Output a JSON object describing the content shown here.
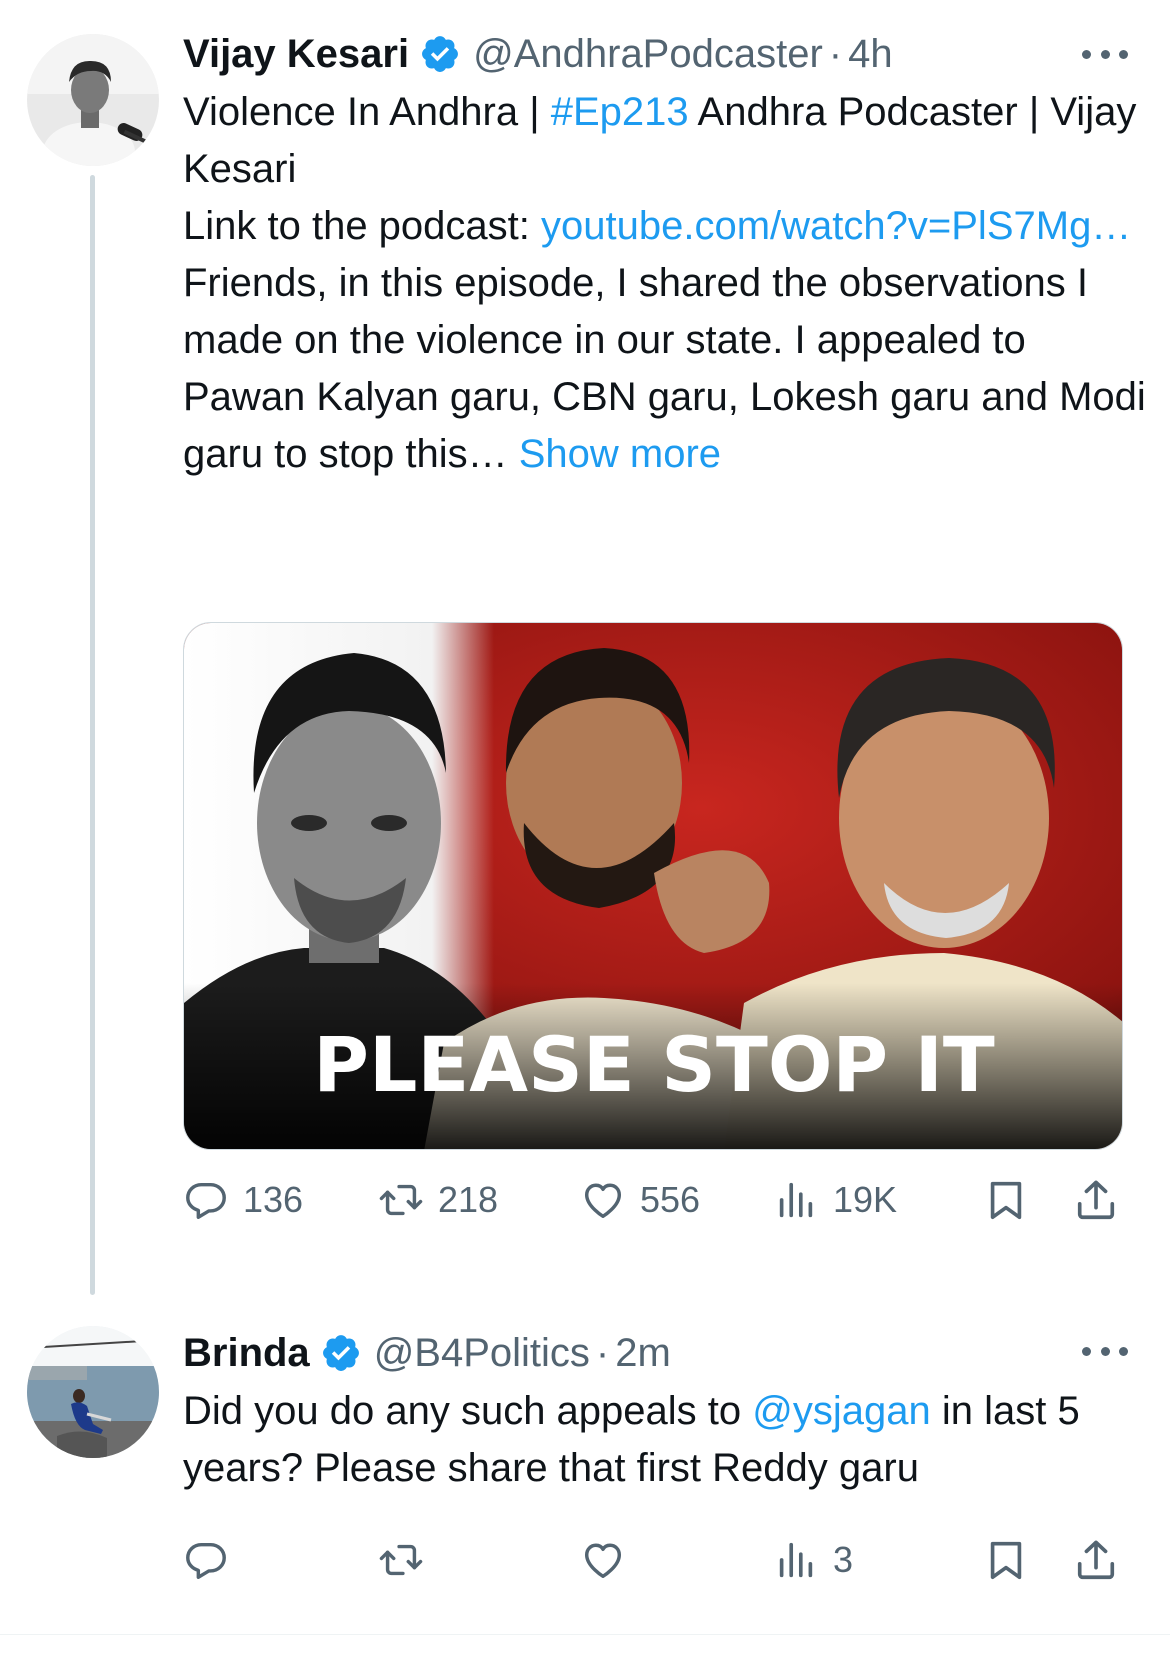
{
  "main_tweet": {
    "author_name": "Vijay Kesari",
    "handle": "@AndhraPodcaster",
    "separator": "·",
    "time": "4h",
    "text": {
      "line1_start": "Violence In Andhra | ",
      "hashtag": "#Ep213",
      "line1_end": " Andhra Podcaster | Vijay Kesari",
      "link_prefix": "Link to the podcast: ",
      "link_text": "youtube.com/watch?v=PlS7Mg…",
      "paragraph": "Friends, in this episode, I shared the observations I made on the violence in our state. I appealed to Pawan Kalyan garu, CBN garu, Lokesh garu and Modi garu to stop this…",
      "show_more": "Show more"
    },
    "media": {
      "overlay_text": "PLEASE STOP IT"
    },
    "actions": {
      "replies": "136",
      "reposts": "218",
      "likes": "556",
      "views": "19K"
    }
  },
  "reply_tweet": {
    "author_name": "Brinda",
    "handle": "@B4Politics",
    "separator": "·",
    "time": "2m",
    "text": {
      "start": "Did you do any such appeals to ",
      "mention": "@ysjagan",
      "end": " in last 5 years? Please share that first Reddy garu"
    },
    "actions": {
      "views": "3"
    }
  },
  "colors": {
    "link_blue": "#1d9bf0",
    "verified_blue": "#1d9bf0",
    "secondary_text": "#536471",
    "primary_text": "#0f1419",
    "thread_line": "#cfd9de"
  },
  "icons": [
    "reply-icon",
    "repost-icon",
    "like-icon",
    "views-icon",
    "bookmark-icon",
    "share-icon",
    "verified-badge-icon",
    "more-icon"
  ]
}
